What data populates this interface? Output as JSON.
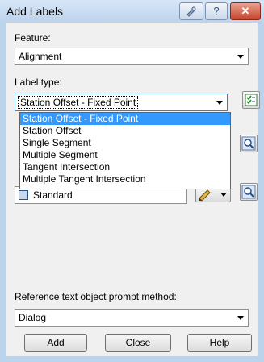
{
  "window": {
    "title": "Add Labels"
  },
  "feature": {
    "label": "Feature:",
    "value": "Alignment"
  },
  "label_type": {
    "label": "Label type:",
    "value": "Station Offset - Fixed Point",
    "options": [
      "Station Offset - Fixed Point",
      "Station Offset",
      "Single Segment",
      "Multiple Segment",
      "Tangent Intersection",
      "Multiple Tangent Intersection"
    ],
    "selected_index": 0
  },
  "style_combo": {
    "value": "Standard"
  },
  "reference": {
    "label": "Reference text object prompt method:",
    "value": "Dialog"
  },
  "buttons": {
    "add": "Add",
    "close": "Close",
    "help": "Help"
  },
  "icons": {
    "help": "question-icon",
    "close": "x-icon",
    "style_manage": "checklist-icon",
    "pick": "magnifier-icon",
    "edit": "pencil-icon"
  }
}
